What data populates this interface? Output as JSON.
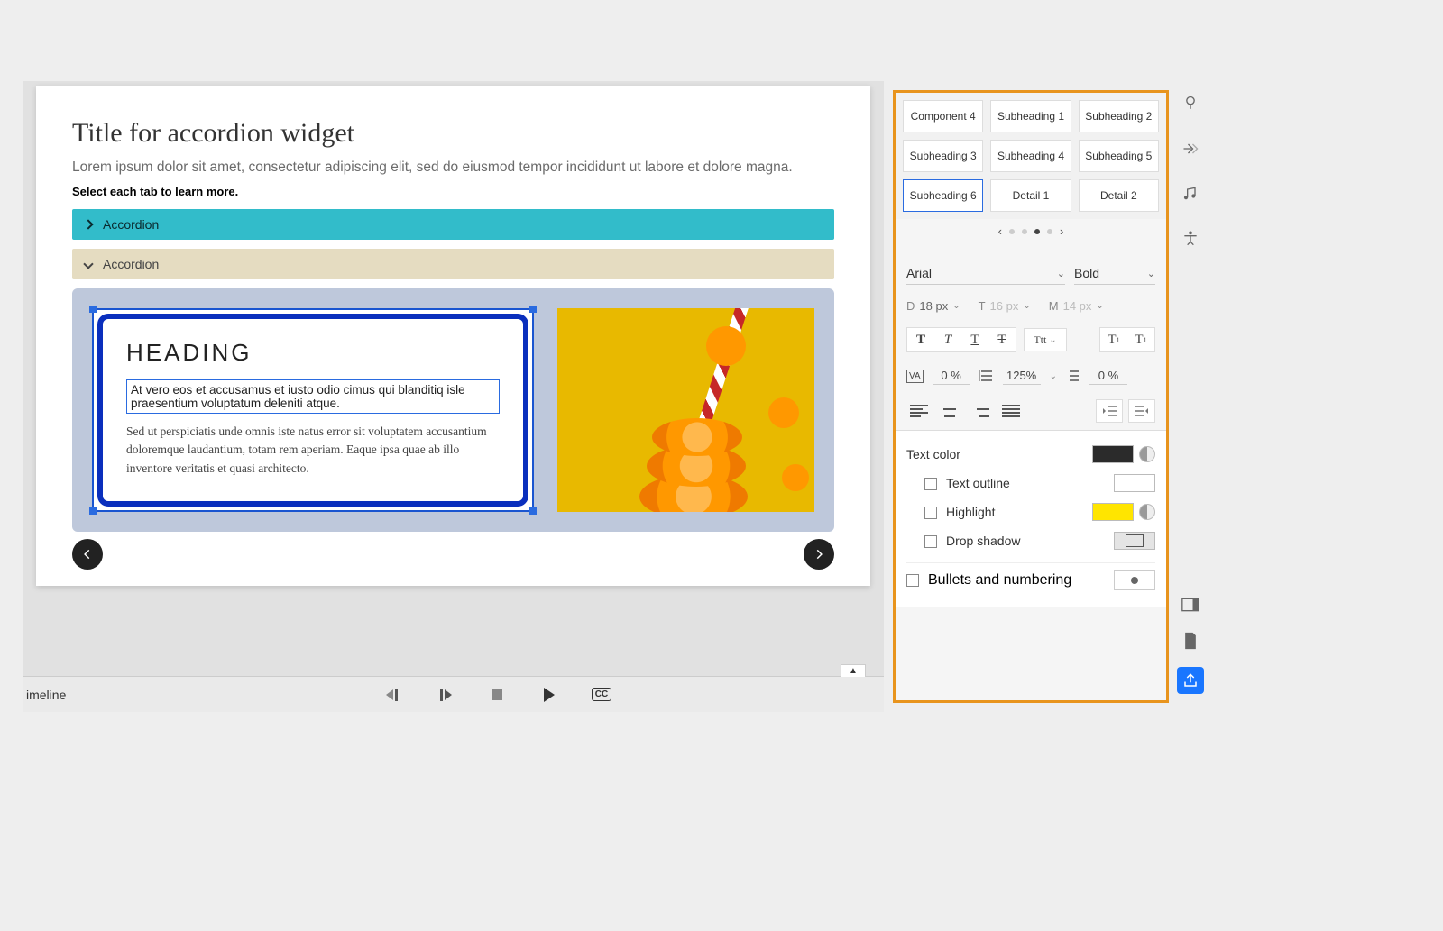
{
  "slide": {
    "title": "Title for accordion widget",
    "sub": "Lorem ipsum dolor sit amet, consectetur adipiscing elit, sed do eiusmod tempor incididunt ut labore et dolore magna.",
    "note": "Select each tab to learn more.",
    "accordion1": "Accordion",
    "accordion2": "Accordion",
    "heading": "HEADING",
    "selected_text": "At vero eos et accusamus et iusto odio cimus qui blanditiq isle praesentium voluptatum deleniti atque.",
    "body_text": "Sed ut perspiciatis unde omnis iste natus error sit voluptatem accusantium doloremque laudantium, totam rem aperiam. Eaque ipsa quae ab illo inventore veritatis et quasi architecto."
  },
  "timeline": {
    "label": "imeline"
  },
  "panel": {
    "styles": [
      "Component 4",
      "Subheading 1",
      "Subheading 2",
      "Subheading 3",
      "Subheading 4",
      "Subheading 5",
      "Subheading 6",
      "Detail 1",
      "Detail 2"
    ],
    "selected_style_index": 6,
    "font_family": "Arial",
    "font_weight": "Bold",
    "sizes": {
      "D_label": "D",
      "D": "18 px",
      "T_label": "T",
      "T": "16 px",
      "M_label": "M",
      "M": "14 px"
    },
    "case_label": "Ttt",
    "letter_spacing": "0 %",
    "line_height": "125%",
    "para_spacing": "0 %",
    "text_color_label": "Text color",
    "text_outline_label": "Text outline",
    "highlight_label": "Highlight",
    "drop_shadow_label": "Drop shadow",
    "bullets_label": "Bullets and numbering",
    "colors": {
      "text": "#2b2b2b",
      "highlight": "#ffe500"
    }
  }
}
